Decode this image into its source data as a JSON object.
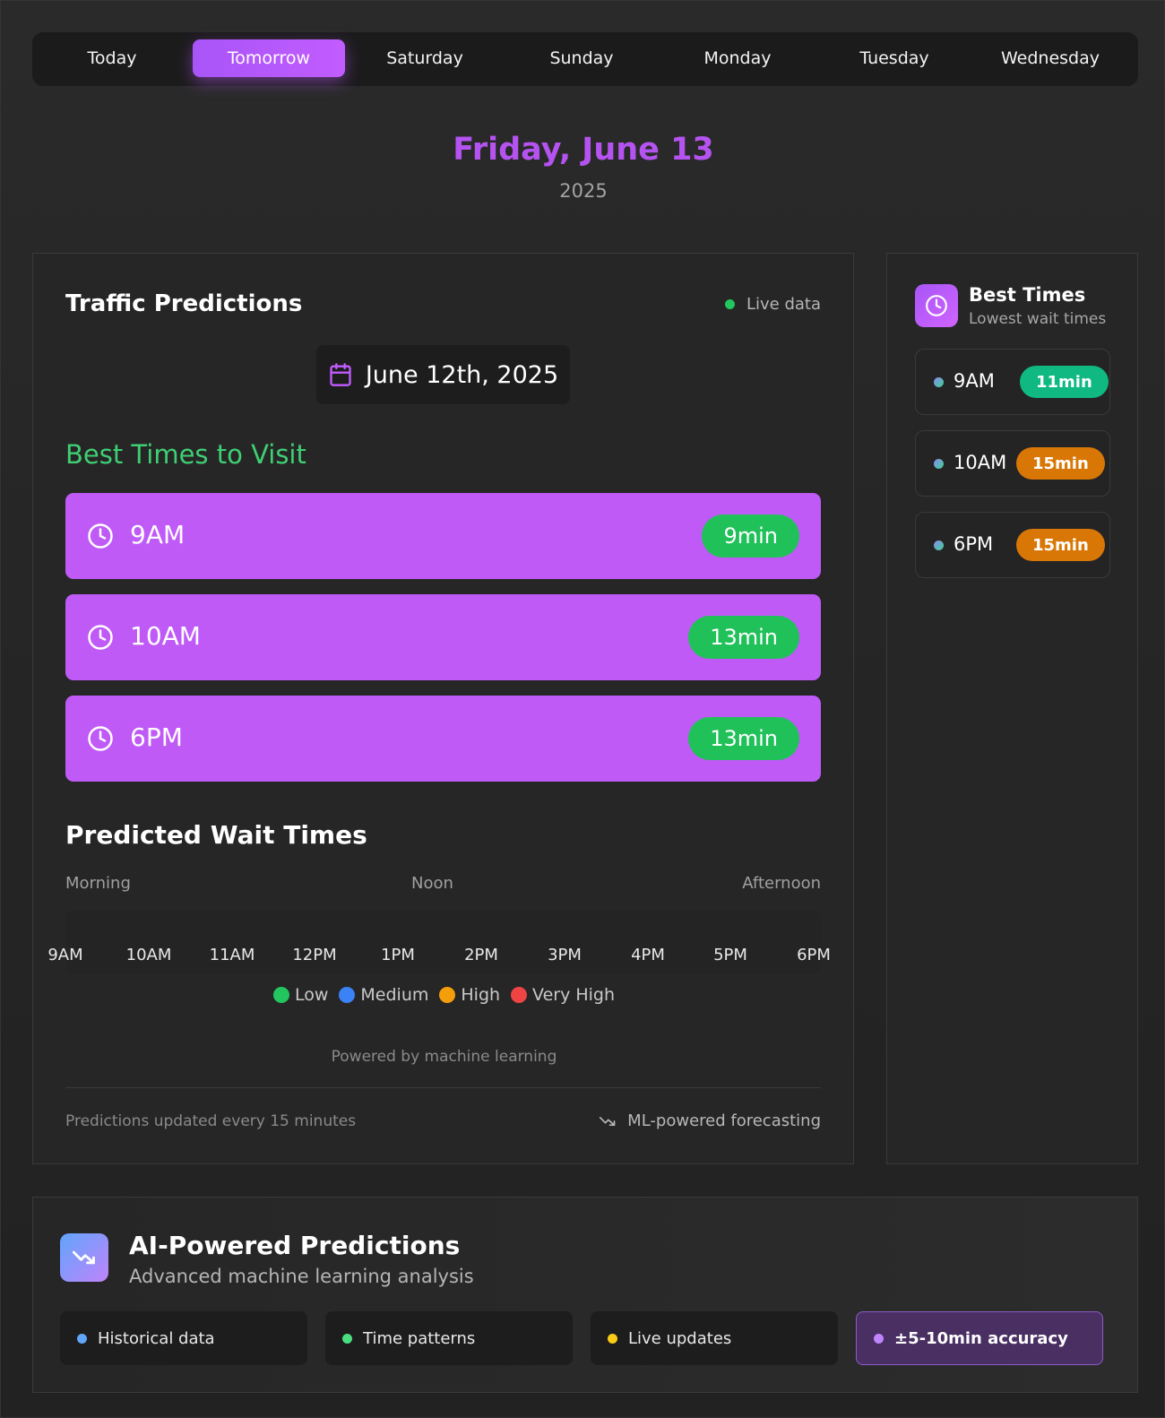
{
  "tabs": [
    "Today",
    "Tomorrow",
    "Saturday",
    "Sunday",
    "Monday",
    "Tuesday",
    "Wednesday"
  ],
  "active_tab": "Tomorrow",
  "header": {
    "date_title": "Friday, June 13",
    "year": "2025"
  },
  "traffic": {
    "title": "Traffic Predictions",
    "live_label": "Live data",
    "date_picker": "June 12th, 2025",
    "best_times_title": "Best Times to Visit",
    "slots": [
      {
        "time": "9AM",
        "wait": "9min"
      },
      {
        "time": "10AM",
        "wait": "13min"
      },
      {
        "time": "6PM",
        "wait": "13min"
      }
    ],
    "predicted_title": "Predicted Wait Times",
    "periods": [
      "Morning",
      "Noon",
      "Afternoon"
    ],
    "hours": [
      "9AM",
      "10AM",
      "11AM",
      "12PM",
      "1PM",
      "2PM",
      "3PM",
      "4PM",
      "5PM",
      "6PM"
    ],
    "legend": [
      {
        "label": "Low",
        "color": "#22c55e"
      },
      {
        "label": "Medium",
        "color": "#3b82f6"
      },
      {
        "label": "High",
        "color": "#f59e0b"
      },
      {
        "label": "Very High",
        "color": "#ef4444"
      }
    ],
    "powered": "Powered by machine learning",
    "updated": "Predictions updated every 15 minutes",
    "ml_label": "ML-powered forecasting"
  },
  "sidebar": {
    "title": "Best Times",
    "subtitle": "Lowest wait times",
    "items": [
      {
        "time": "9AM",
        "wait": "11min",
        "color": "#10b981"
      },
      {
        "time": "10AM",
        "wait": "15min",
        "color": "#d97706"
      },
      {
        "time": "6PM",
        "wait": "15min",
        "color": "#d97706"
      }
    ]
  },
  "ai": {
    "title": "AI-Powered Predictions",
    "subtitle": "Advanced machine learning analysis",
    "chips": [
      {
        "label": "Historical data",
        "color": "#60a5fa"
      },
      {
        "label": "Time patterns",
        "color": "#4ade80"
      },
      {
        "label": "Live updates",
        "color": "#facc15"
      },
      {
        "label": "±5-10min accuracy",
        "color": "#c084fc"
      }
    ]
  }
}
